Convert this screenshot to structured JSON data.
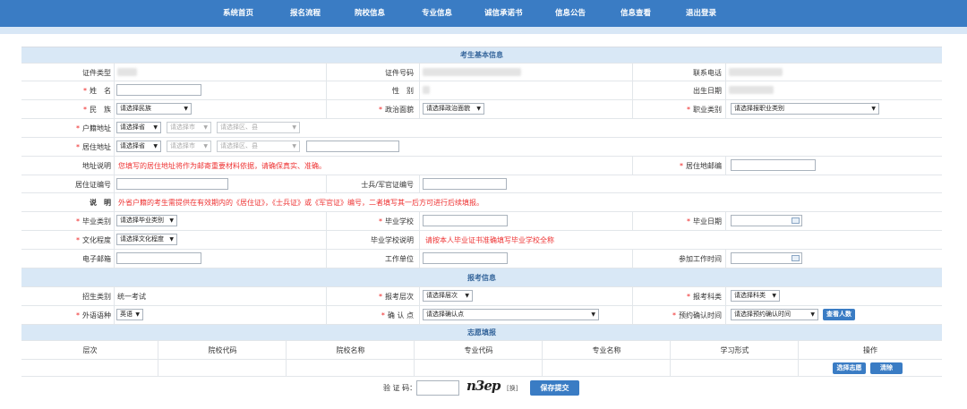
{
  "nav": {
    "items": [
      "系统首页",
      "报名流程",
      "院校信息",
      "专业信息",
      "诚信承诺书",
      "信息公告",
      "信息查看",
      "退出登录"
    ]
  },
  "colors": {
    "nav_bg": "#3a7cc4",
    "section_bg": "#d9e8f6",
    "required": "#e22222"
  },
  "sections": {
    "basic": "考生基本信息",
    "apply": "报考信息",
    "wish": "志愿填报"
  },
  "basic": {
    "id_type_label": "证件类型",
    "id_number_label": "证件号码",
    "phone_label": "联系电话",
    "name_label": "姓　名",
    "gender_label": "性　别",
    "birth_label": "出生日期",
    "ethnic_label": "民　族",
    "ethnic_select": "请选择民族",
    "political_label": "政治面貌",
    "political_select": "请选择政治面貌",
    "job_label": "职业类别",
    "job_select": "请选择报职业类别",
    "hukou_label": "户籍地址",
    "residence_label": "居住地址",
    "province_select": "请选择省",
    "city_select": "请选择市",
    "district_select": "请选择区、县",
    "addr_note_label": "地址说明",
    "addr_note": "您填写的居住地址将作为邮寄重要材料依据，请确保真实、准确。",
    "postcode_label": "居住地邮编",
    "residence_permit_label": "居住证编号",
    "soldier_label": "士兵/军官证编号",
    "note_label": "说　明",
    "note": "外省户籍的考生需提供在有效期内的《居住证》，《士兵证》或《军官证》编号，二者填写其一后方可进行后续填报。",
    "grad_type_label": "毕业类别",
    "grad_type_select": "请选择毕业类别",
    "grad_school_label": "毕业学校",
    "grad_date_label": "毕业日期",
    "edu_label": "文化程度",
    "edu_select": "请选择文化程度",
    "school_note_label": "毕业学校说明",
    "school_note": "请按本人毕业证书准确填写毕业学校全称",
    "email_label": "电子邮箱",
    "work_unit_label": "工作单位",
    "work_time_label": "参加工作时间"
  },
  "apply": {
    "enroll_type_label": "招生类别",
    "enroll_type_value": "统一考试",
    "level_label": "报考层次",
    "level_select": "请选择层次",
    "subject_label": "报考科类",
    "subject_select": "请选择科类",
    "lang_label": "外语语种",
    "lang_select": "英语",
    "confirm_label": "确 认 点",
    "confirm_select": "请选择确认点",
    "reserve_label": "预约确认时间",
    "reserve_select": "请选择预约确认时间",
    "check_button": "查看人数"
  },
  "wish": {
    "headers": [
      "层次",
      "院校代码",
      "院校名称",
      "专业代码",
      "专业名称",
      "学习形式",
      "操作"
    ],
    "choose_button": "选择志愿",
    "clear_button": "清除"
  },
  "footer": {
    "captcha_label": "验 证 码：",
    "captcha_text": "n3ep",
    "refresh": "[换]",
    "submit_button": "保存提交"
  }
}
